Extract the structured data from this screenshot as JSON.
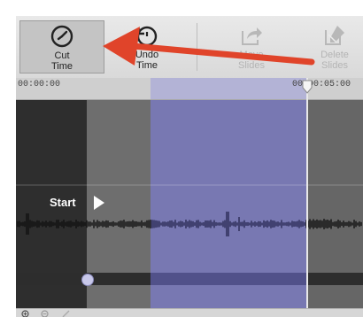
{
  "toolbar": {
    "cut_time": {
      "label": "Cut\nTime",
      "icon": "clock-icon",
      "active": true
    },
    "undo_time": {
      "label": "Undo\nTime",
      "icon": "undo-clock-icon"
    },
    "move_slides": {
      "label": "Move\nSlides",
      "icon": "share-arrow-icon",
      "disabled": true
    },
    "delete_slides": {
      "label": "Delete\nSlides",
      "icon": "delete-slide-icon",
      "disabled": true
    }
  },
  "timeline": {
    "start_time": "00:00:00",
    "playhead_time": "00:00:05:00"
  },
  "track": {
    "start_label": "Start",
    "start_arrow": "play-triangle-icon"
  },
  "statusbar": {
    "icons": [
      "zoom-in-icon",
      "zoom-out-icon",
      "edit-icon"
    ]
  },
  "annotation": {
    "color": "#e0442a",
    "points_to": "cut-time-button"
  },
  "colors": {
    "selection": "#7878b2",
    "waveform": "#1a1a1a",
    "annotation_arrow": "#e0442a"
  }
}
